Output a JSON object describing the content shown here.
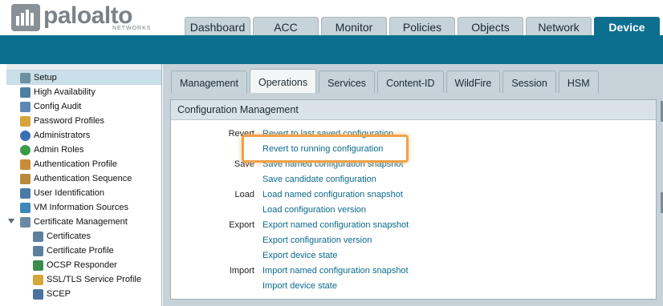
{
  "brand": {
    "name": "paloalto",
    "sub": "NETWORKS"
  },
  "main_tabs": [
    {
      "label": "Dashboard",
      "active": false
    },
    {
      "label": "ACC",
      "active": false
    },
    {
      "label": "Monitor",
      "active": false
    },
    {
      "label": "Policies",
      "active": false
    },
    {
      "label": "Objects",
      "active": false
    },
    {
      "label": "Network",
      "active": false
    },
    {
      "label": "Device",
      "active": true
    }
  ],
  "sidebar": {
    "items": [
      {
        "label": "Setup",
        "icon": "setup-icon",
        "selected": true
      },
      {
        "label": "High Availability",
        "icon": "high-availability-icon"
      },
      {
        "label": "Config Audit",
        "icon": "config-audit-icon"
      },
      {
        "label": "Password Profiles",
        "icon": "password-profiles-icon"
      },
      {
        "label": "Administrators",
        "icon": "administrators-icon"
      },
      {
        "label": "Admin Roles",
        "icon": "admin-roles-icon"
      },
      {
        "label": "Authentication Profile",
        "icon": "authentication-profile-icon"
      },
      {
        "label": "Authentication Sequence",
        "icon": "authentication-sequence-icon"
      },
      {
        "label": "User Identification",
        "icon": "user-identification-icon"
      },
      {
        "label": "VM Information Sources",
        "icon": "vm-information-sources-icon"
      },
      {
        "label": "Certificate Management",
        "icon": "certificate-management-icon",
        "expandable": true
      },
      {
        "label": "Certificates",
        "icon": "certificates-icon",
        "child": true
      },
      {
        "label": "Certificate Profile",
        "icon": "certificate-profile-icon",
        "child": true
      },
      {
        "label": "OCSP Responder",
        "icon": "ocsp-responder-icon",
        "child": true
      },
      {
        "label": "SSL/TLS Service Profile",
        "icon": "ssl-tls-service-profile-icon",
        "child": true
      },
      {
        "label": "SCEP",
        "icon": "scep-icon",
        "child": true
      }
    ]
  },
  "sub_tabs": [
    {
      "label": "Management",
      "active": false
    },
    {
      "label": "Operations",
      "active": true
    },
    {
      "label": "Services",
      "active": false
    },
    {
      "label": "Content-ID",
      "active": false
    },
    {
      "label": "WildFire",
      "active": false
    },
    {
      "label": "Session",
      "active": false
    },
    {
      "label": "HSM",
      "active": false
    }
  ],
  "config_management": {
    "title": "Configuration Management",
    "rows": [
      {
        "label": "Revert",
        "link": "Revert to last saved configuration"
      },
      {
        "label": "",
        "link": "Revert to running configuration"
      },
      {
        "label": "Save",
        "link": "Save named configuration snapshot"
      },
      {
        "label": "",
        "link": "Save candidate configuration"
      },
      {
        "label": "Load",
        "link": "Load named configuration snapshot"
      },
      {
        "label": "",
        "link": "Load configuration version"
      },
      {
        "label": "Export",
        "link": "Export named configuration snapshot"
      },
      {
        "label": "",
        "link": "Export configuration version"
      },
      {
        "label": "",
        "link": "Export device state"
      },
      {
        "label": "Import",
        "link": "Import named configuration snapshot"
      },
      {
        "label": "",
        "link": "Import device state"
      }
    ]
  },
  "colors": {
    "brand_teal": "#0d6f8f",
    "link": "#0b6a8a",
    "highlight": "#f0a34a",
    "selected_row": "#c9dfe9"
  }
}
